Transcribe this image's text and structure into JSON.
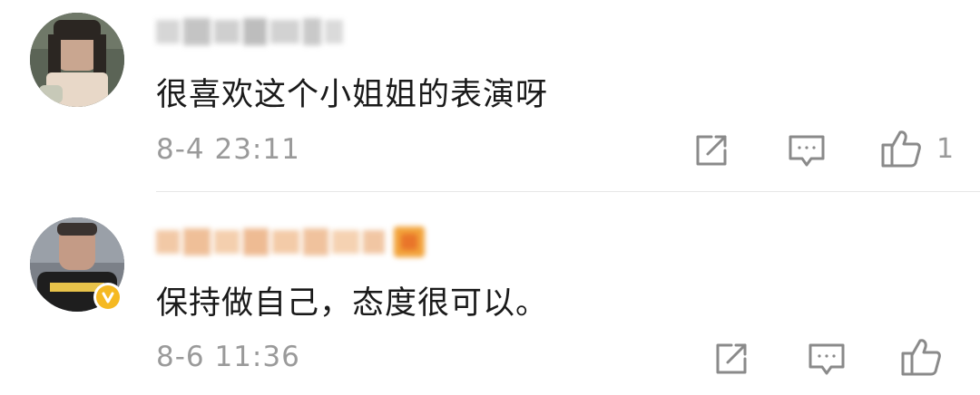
{
  "comments": [
    {
      "text": "很喜欢这个小姐姐的表演呀",
      "timestamp": "8-4 23:11",
      "like_count": "1"
    },
    {
      "text": "保持做自己，态度很可以。",
      "timestamp": "8-6 11:36",
      "like_count": ""
    }
  ],
  "icons": {
    "share": "share-icon",
    "reply": "comment-icon",
    "like": "thumbs-up-icon",
    "verified": "verified-badge-icon"
  },
  "colors": {
    "text": "#1a1a1a",
    "meta": "#9a9a9a",
    "icon": "#8a8a8a",
    "divider": "#e6e6e6",
    "verified": "#f5b922"
  }
}
